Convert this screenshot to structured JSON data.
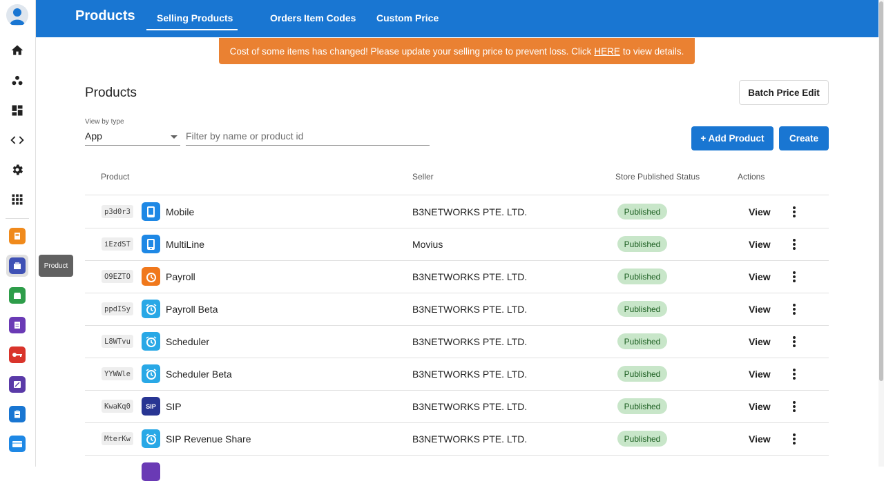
{
  "topbar": {
    "title": "Products",
    "tabs": [
      {
        "label": "Selling Products",
        "active": true
      },
      {
        "label": "Orders"
      },
      {
        "label": "Item Codes"
      },
      {
        "label": "Custom Price"
      }
    ]
  },
  "banner": {
    "text_before": "Cost of some items has changed! Please update your selling price to prevent loss. Click",
    "link": "HERE",
    "text_after": "to view details."
  },
  "page": {
    "title": "Products",
    "batch_button": "Batch Price Edit",
    "add_button": "+ Add Product",
    "create_button": "Create"
  },
  "filters": {
    "type_label": "View by type",
    "type_value": "App",
    "search_placeholder": "Filter by name or product id",
    "search_value": ""
  },
  "table": {
    "headers": {
      "product": "Product",
      "seller": "Seller",
      "status": "Store Published Status",
      "actions": "Actions"
    },
    "rows": [
      {
        "code": "p3d0r3",
        "name": "Mobile",
        "seller": "B3NETWORKS PTE. LTD.",
        "status": "Published",
        "action": "View",
        "icon": "mobile-icon"
      },
      {
        "code": "iEzdST",
        "name": "MultiLine",
        "seller": "Movius",
        "status": "Published",
        "action": "View",
        "icon": "multiline-icon"
      },
      {
        "code": "O9EZTO",
        "name": "Payroll",
        "seller": "B3NETWORKS PTE. LTD.",
        "status": "Published",
        "action": "View",
        "icon": "payroll-icon"
      },
      {
        "code": "ppdISy",
        "name": "Payroll Beta",
        "seller": "B3NETWORKS PTE. LTD.",
        "status": "Published",
        "action": "View",
        "icon": "alarm-clock-icon"
      },
      {
        "code": "L8WTvu",
        "name": "Scheduler",
        "seller": "B3NETWORKS PTE. LTD.",
        "status": "Published",
        "action": "View",
        "icon": "alarm-clock-icon"
      },
      {
        "code": "YYWWle",
        "name": "Scheduler Beta",
        "seller": "B3NETWORKS PTE. LTD.",
        "status": "Published",
        "action": "View",
        "icon": "alarm-clock-icon"
      },
      {
        "code": "KwaKq0",
        "name": "SIP",
        "seller": "B3NETWORKS PTE. LTD.",
        "status": "Published",
        "action": "View",
        "icon": "sip-icon"
      },
      {
        "code": "MterKw",
        "name": "SIP Revenue Share",
        "seller": "B3NETWORKS PTE. LTD.",
        "status": "Published",
        "action": "View",
        "icon": "alarm-clock-icon"
      }
    ]
  },
  "sidebar": {
    "tooltip": "Product",
    "sip_icon_text": "SIP"
  },
  "colors": {
    "primary": "#1976d2",
    "banner": "#ea8132",
    "badge_bg": "#c8e6c9",
    "badge_text": "#1b5e20"
  }
}
